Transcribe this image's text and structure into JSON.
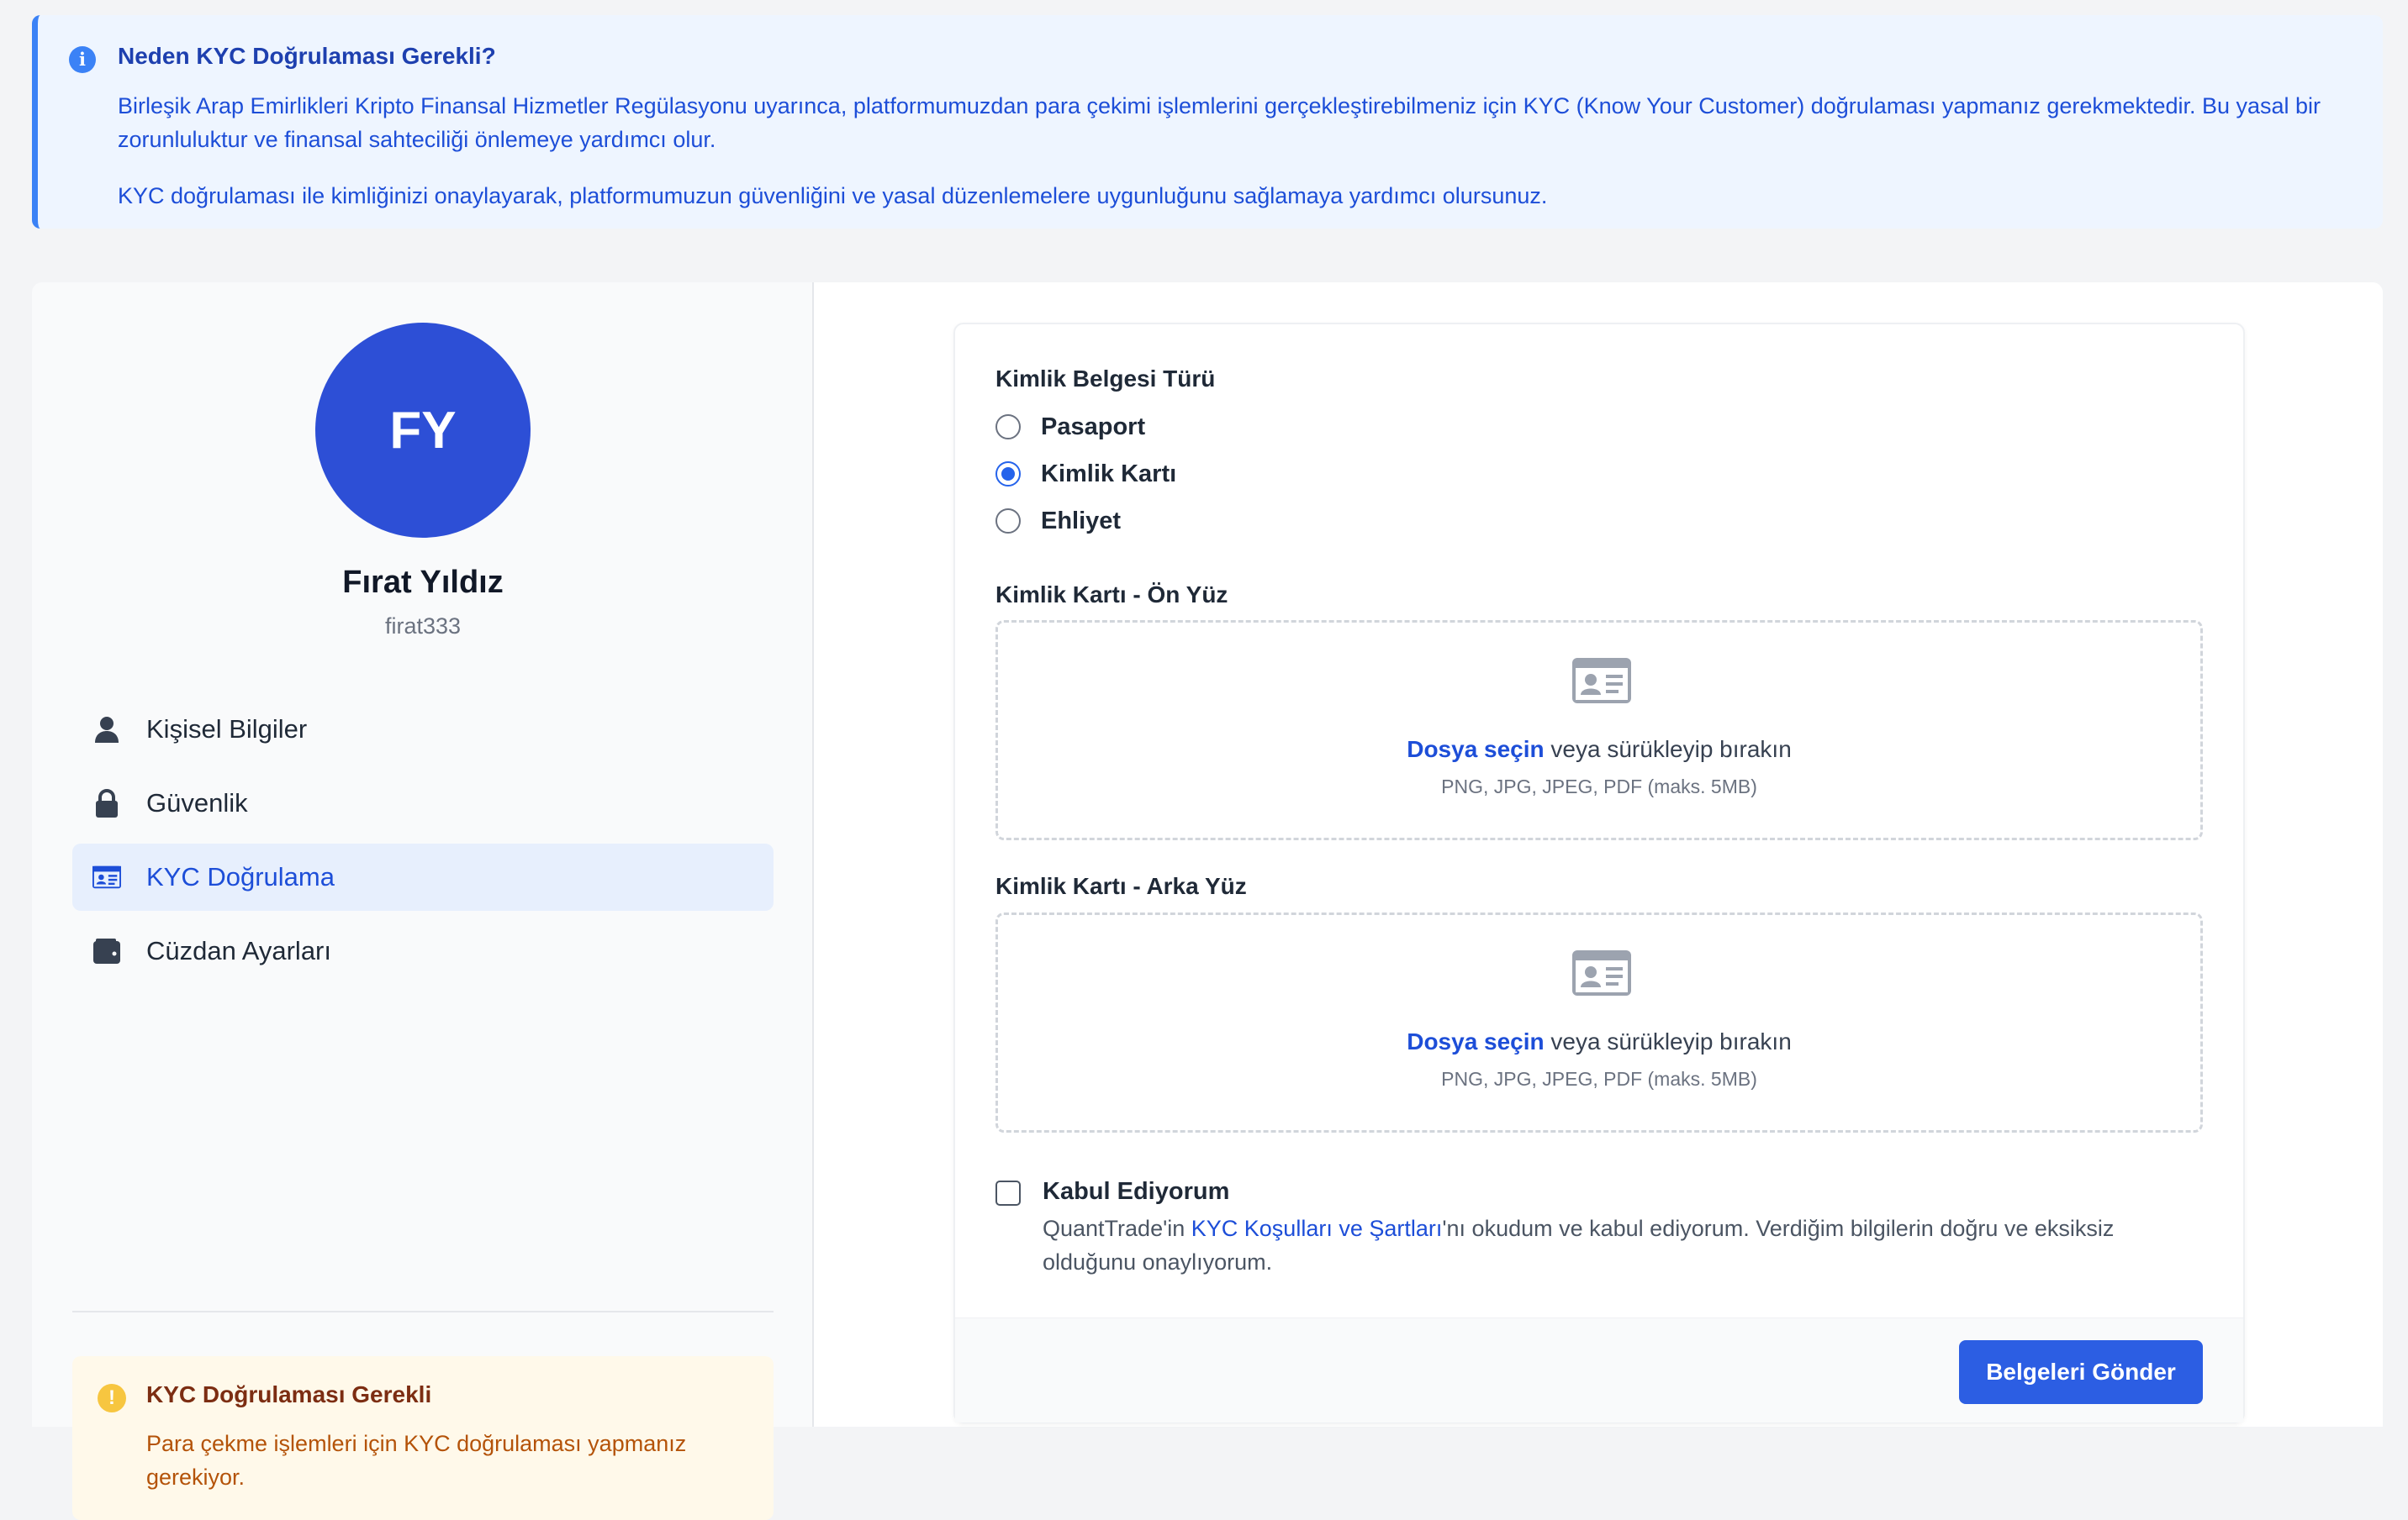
{
  "info": {
    "title": "Neden KYC Doğrulaması Gerekli?",
    "paragraph1": "Birleşik Arap Emirlikleri Kripto Finansal Hizmetler Regülasyonu uyarınca, platformumuzdan para çekimi işlemlerini gerçekleştirebilmeniz için KYC (Know Your Customer) doğrulaması yapmanız gerekmektedir. Bu yasal bir zorunluluktur ve finansal sahteciliği önlemeye yardımcı olur.",
    "paragraph2": "KYC doğrulaması ile kimliğinizi onaylayarak, platformumuzun güvenliğini ve yasal düzenlemelere uygunluğunu sağlamaya yardımcı olursunuz."
  },
  "profile": {
    "initials": "FY",
    "name": "Fırat Yıldız",
    "username": "firat333"
  },
  "nav": [
    {
      "label": "Kişisel Bilgiler",
      "icon": "user-icon",
      "active": false
    },
    {
      "label": "Güvenlik",
      "icon": "lock-icon",
      "active": false
    },
    {
      "label": "KYC Doğrulama",
      "icon": "id-card-icon",
      "active": true
    },
    {
      "label": "Cüzdan Ayarları",
      "icon": "wallet-icon",
      "active": false
    }
  ],
  "warning": {
    "title": "KYC Doğrulaması Gerekli",
    "text": "Para çekme işlemleri için KYC doğrulaması yapmanız gerekiyor."
  },
  "form": {
    "doc_type_label": "Kimlik Belgesi Türü",
    "options": [
      {
        "label": "Pasaport",
        "checked": false
      },
      {
        "label": "Kimlik Kartı",
        "checked": true
      },
      {
        "label": "Ehliyet",
        "checked": false
      }
    ],
    "front_label": "Kimlik Kartı - Ön Yüz",
    "back_label": "Kimlik Kartı - Arka Yüz",
    "upload": {
      "link": "Dosya seçin",
      "text": " veya sürükleyip bırakın",
      "hint": "PNG, JPG, JPEG, PDF (maks. 5MB)"
    },
    "accept": {
      "title": "Kabul Ediyorum",
      "prefix": "QuantTrade'in ",
      "link": "KYC Koşulları ve Şartları",
      "suffix": "'nı okudum ve kabul ediyorum. Verdiğim bilgilerin doğru ve eksiksiz olduğunu onaylıyorum.",
      "checked": false
    },
    "submit": "Belgeleri Gönder"
  },
  "colors": {
    "primary": "#2c5ee3",
    "info_bg": "#eef5ff",
    "warning_bg": "#fff9ea",
    "avatar": "#2d4fd6"
  }
}
